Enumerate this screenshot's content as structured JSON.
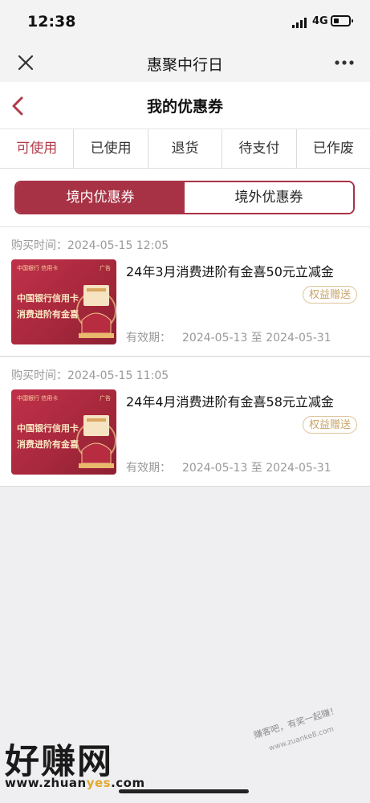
{
  "status_bar": {
    "time": "12:38",
    "network": "4G"
  },
  "nav": {
    "title": "惠聚中行日"
  },
  "header": {
    "title": "我的优惠券"
  },
  "status_tabs": [
    "可使用",
    "已使用",
    "退货",
    "待支付",
    "已作废"
  ],
  "active_status_tab": "可使用",
  "segment": {
    "domestic": "境内优惠券",
    "overseas": "境外优惠券",
    "active": "境内优惠券"
  },
  "coupons": [
    {
      "purchase_label": "购买时间：",
      "purchase_time": "2024-05-15 12:05",
      "name": "24年3月消费进阶有金喜50元立减金",
      "tag": "权益赠送",
      "validity_label": "有效期：",
      "validity": "2024-05-13 至 2024-05-31",
      "thumb": {
        "bank": "中国银行 信用卡",
        "ad": "广告",
        "line1": "中国银行信用卡",
        "line2": "消费进阶有金喜"
      }
    },
    {
      "purchase_label": "购买时间：",
      "purchase_time": "2024-05-15 11:05",
      "name": "24年4月消费进阶有金喜58元立减金",
      "tag": "权益赠送",
      "validity_label": "有效期：",
      "validity": "2024-05-13 至 2024-05-31",
      "thumb": {
        "bank": "中国银行 信用卡",
        "ad": "广告",
        "line1": "中国银行信用卡",
        "line2": "消费进阶有金喜"
      }
    }
  ],
  "watermark": {
    "brand": "好赚网",
    "url_pre": "www.zhuan",
    "url_yes": "yes",
    "url_post": ".com",
    "slogan": "赚客吧，有奖一起赚！",
    "slogan_url": "www.zuanke8.com"
  },
  "colors": {
    "accent": "#a83245",
    "active_tab_text": "#b23a48",
    "tag_gold": "#c9a46a"
  }
}
